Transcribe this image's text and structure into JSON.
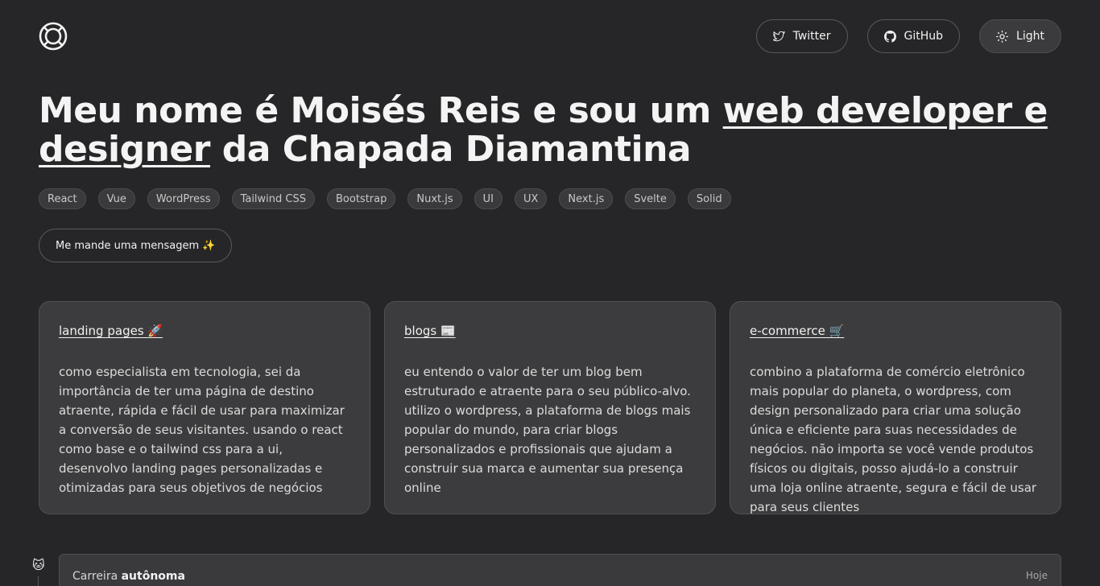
{
  "header": {
    "nav": [
      {
        "label": "Twitter",
        "icon": "twitter-icon"
      },
      {
        "label": "GitHub",
        "icon": "github-icon"
      },
      {
        "label": "Light",
        "icon": "sun-icon"
      }
    ]
  },
  "hero": {
    "title_start": "Meu nome é Moisés Reis e sou um ",
    "title_highlight": "web developer e designer",
    "title_end": " da Chapada Diamantina",
    "tags": [
      "React",
      "Vue",
      "WordPress",
      "Tailwind CSS",
      "Bootstrap",
      "Nuxt.js",
      "UI",
      "UX",
      "Next.js",
      "Svelte",
      "Solid"
    ],
    "cta_label": "Me mande uma mensagem ✨"
  },
  "cards": [
    {
      "title": "landing pages 🚀",
      "text": "como especialista em tecnologia, sei da importância de ter uma página de destino atraente, rápida e fácil de usar para maximizar a conversão de seus visitantes. usando o react como base e o tailwind css para a ui, desenvolvo landing pages personalizadas e otimizadas para seus objetivos de negócios"
    },
    {
      "title": "blogs 📰",
      "text": "eu entendo o valor de ter um blog bem estruturado e atraente para o seu público-alvo. utilizo o wordpress, a plataforma de blogs mais popular do mundo, para criar blogs personalizados e profissionais que ajudam a construir sua marca e aumentar sua presença online"
    },
    {
      "title": "e-commerce 🛒",
      "text": "combino a plataforma de comércio eletrônico mais popular do planeta, o wordpress, com design personalizado para criar uma solução única e eficiente para suas necessidades de negócios. não importa se você vende produtos físicos ou digitais, posso ajudá-lo a construir uma loja online atraente, segura e fácil de usar para seus clientes"
    }
  ],
  "timeline": {
    "icon": "🐱",
    "label": "Carreira",
    "label_bold": "autônoma",
    "date": "Hoje"
  }
}
